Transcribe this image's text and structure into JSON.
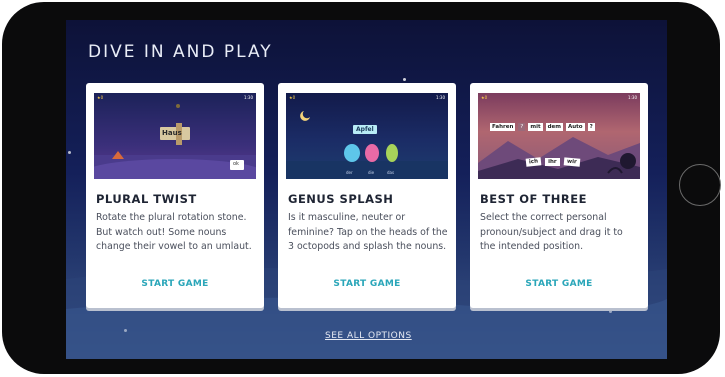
{
  "section_title": "DIVE IN AND PLAY",
  "cards": [
    {
      "title": "PLURAL TWIST",
      "description": "Rotate the plural rotation stone. But watch out! Some nouns change their vowel to an umlaut.",
      "cta": "START GAME",
      "thumb": {
        "word": "Haus",
        "ok_label": "ok",
        "timer": "1:30"
      }
    },
    {
      "title": "GENUS SPLASH",
      "description": "Is it masculine, neuter or feminine? Tap on the heads of the 3 octopods and splash the nouns.",
      "cta": "START GAME",
      "thumb": {
        "word": "Apfel",
        "articles": [
          "der",
          "die",
          "das"
        ],
        "timer": "1:30"
      }
    },
    {
      "title": "BEST OF THREE",
      "description": "Select the correct personal pronoun/subject and drag it to the intended position.",
      "cta": "START GAME",
      "thumb": {
        "sentence": [
          "Fahren",
          "?",
          "mit",
          "dem",
          "Auto",
          "?"
        ],
        "choices": [
          "ich",
          "ihr",
          "wir"
        ],
        "timer": "1:30"
      }
    }
  ],
  "see_all_label": "SEE ALL OPTIONS",
  "colors": {
    "accent": "#2aa6b9",
    "screen_top": "#0d1238",
    "screen_bottom": "#3b5688"
  }
}
